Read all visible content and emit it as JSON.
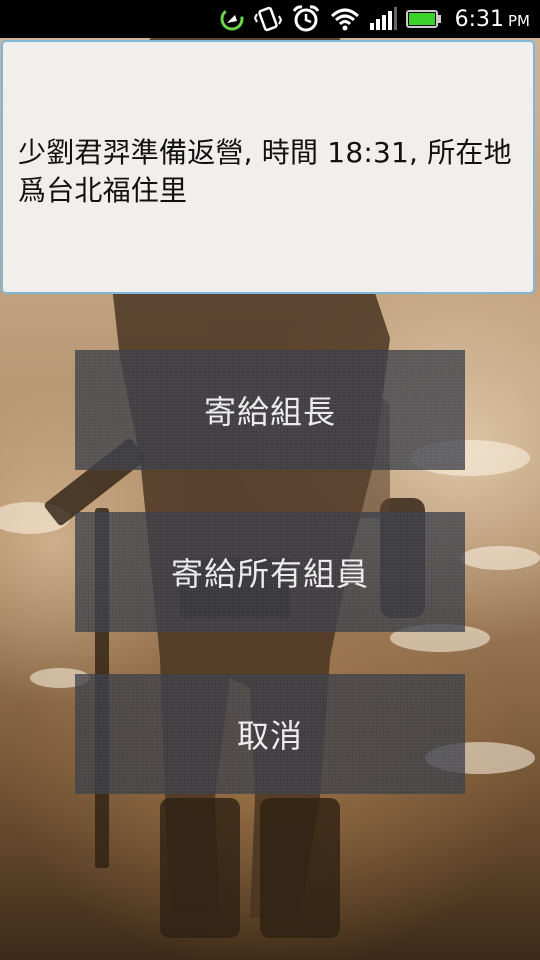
{
  "status_bar": {
    "time": "6:31",
    "ampm": "PM",
    "icons": [
      "sync-icon",
      "vibrate-icon",
      "alarm-icon",
      "wifi-icon",
      "signal-icon",
      "battery-icon"
    ]
  },
  "message": {
    "text": "少劉君羿準備返營, 時間 18:31, 所在地爲台北福住里"
  },
  "actions": {
    "send_leader": "寄給組長",
    "send_all": "寄給所有組員",
    "cancel": "取消"
  },
  "colors": {
    "message_border": "#7fb6d9",
    "message_background": "#f1efeb",
    "button_background": "#3a3e48",
    "battery_green": "#3bd12b"
  }
}
